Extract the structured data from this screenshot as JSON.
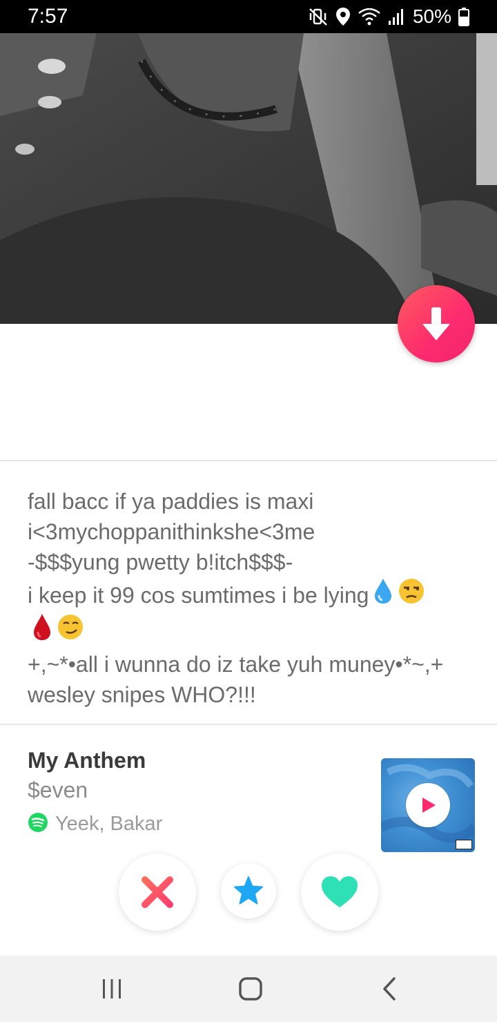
{
  "status_bar": {
    "time": "7:57",
    "battery": "50%",
    "icons": [
      "mute-vibrate-icon",
      "location-icon",
      "wifi-icon",
      "signal-icon",
      "battery-icon"
    ]
  },
  "profile": {
    "bio_lines": [
      "fall bacc if ya paddies is maxi",
      "i<3mychoppanithinkshe<3me",
      "-$$$yung pwetty b!itch$$$-",
      "i keep it 99 cos sumtimes i be lying",
      "",
      "+,~*•all i wunna do iz take yuh muney•*~,+",
      "wesley snipes WHO?!!!"
    ],
    "bio_emojis": [
      "droplet",
      "unamused-face",
      "drop-of-blood",
      "smirking-face"
    ]
  },
  "anthem": {
    "label": "My Anthem",
    "song": "$even",
    "artist": "Yeek, Bakar"
  },
  "colors": {
    "accent_red": "#fd2b6e",
    "nope": "#fd5068",
    "super_like": "#1ea7f5",
    "like": "#2ee0b6",
    "spotify": "#1ed760"
  }
}
